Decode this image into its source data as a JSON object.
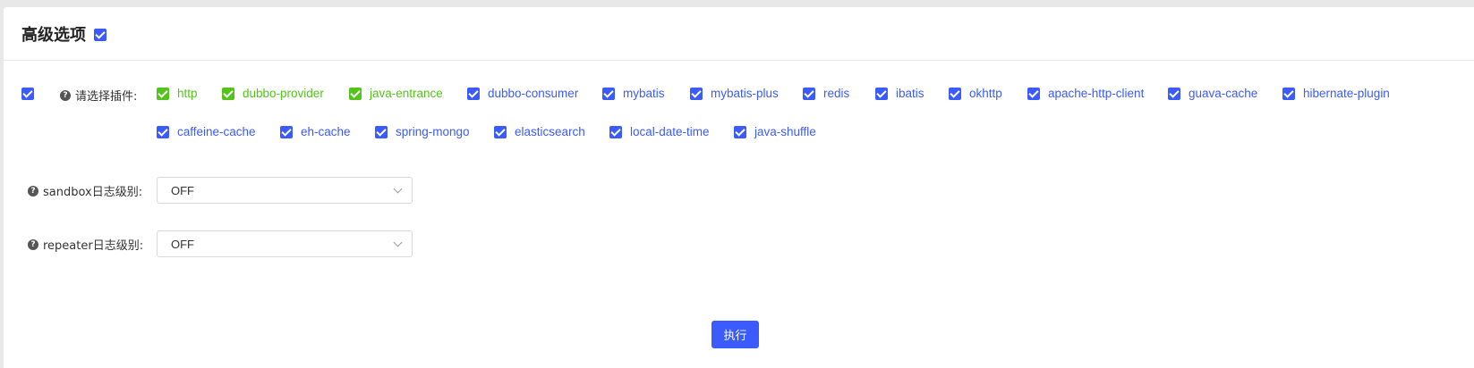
{
  "section": {
    "title": "高级选项",
    "enabled": true
  },
  "plugins": {
    "label": "请选择插件:",
    "help_icon": "question-circle-icon",
    "items": [
      {
        "name": "http",
        "checked": true,
        "color": "#52c41a"
      },
      {
        "name": "dubbo-provider",
        "checked": true,
        "color": "#52c41a"
      },
      {
        "name": "java-entrance",
        "checked": true,
        "color": "#52c41a"
      },
      {
        "name": "dubbo-consumer",
        "checked": true,
        "color": "#3b5bfc"
      },
      {
        "name": "mybatis",
        "checked": true,
        "color": "#3b5bfc"
      },
      {
        "name": "mybatis-plus",
        "checked": true,
        "color": "#3b5bfc"
      },
      {
        "name": "redis",
        "checked": true,
        "color": "#3b5bfc"
      },
      {
        "name": "ibatis",
        "checked": true,
        "color": "#3b5bfc"
      },
      {
        "name": "okhttp",
        "checked": true,
        "color": "#3b5bfc"
      },
      {
        "name": "apache-http-client",
        "checked": true,
        "color": "#3b5bfc"
      },
      {
        "name": "guava-cache",
        "checked": true,
        "color": "#3b5bfc"
      },
      {
        "name": "hibernate-plugin",
        "checked": true,
        "color": "#3b5bfc"
      },
      {
        "name": "caffeine-cache",
        "checked": true,
        "color": "#3b5bfc"
      },
      {
        "name": "eh-cache",
        "checked": true,
        "color": "#3b5bfc"
      },
      {
        "name": "spring-mongo",
        "checked": true,
        "color": "#3b5bfc"
      },
      {
        "name": "elasticsearch",
        "checked": true,
        "color": "#3b5bfc"
      },
      {
        "name": "local-date-time",
        "checked": true,
        "color": "#3b5bfc"
      },
      {
        "name": "java-shuffle",
        "checked": true,
        "color": "#3b5bfc"
      }
    ]
  },
  "sandbox_log": {
    "label": "sandbox日志级别:",
    "value": "OFF"
  },
  "repeater_log": {
    "label": "repeater日志级别:",
    "value": "OFF"
  },
  "actions": {
    "execute_label": "执行"
  },
  "colors": {
    "accent": "#3b5bfc",
    "checked_default": "#52c41a"
  }
}
